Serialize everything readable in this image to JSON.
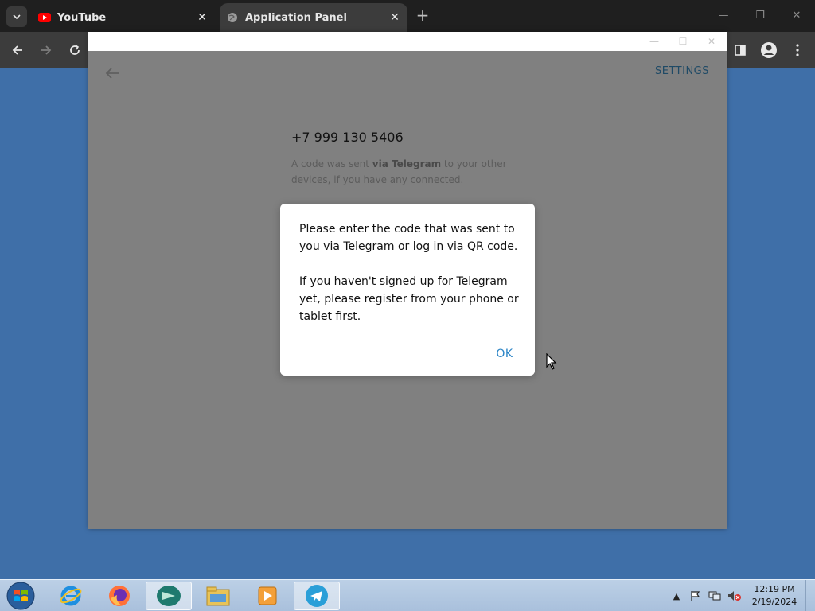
{
  "browser": {
    "tabs": [
      {
        "label": "YouTube",
        "icon": "youtube-icon"
      },
      {
        "label": "Application Panel",
        "icon": "globe-icon",
        "active": true
      }
    ],
    "new_tab_icon": "plus-icon"
  },
  "app": {
    "settings_label": "SETTINGS",
    "phone_number": "+7 999 130 5406",
    "hint_prefix": "A code was sent ",
    "hint_bold": "via Telegram",
    "hint_suffix": " to your other devices, if you have any connected."
  },
  "dialog": {
    "paragraph1": "Please enter the code that was sent to you via Telegram or log in via QR code.",
    "paragraph2": "If you haven't signed up for Telegram yet, please register from your phone or tablet first.",
    "ok_label": "OK"
  },
  "taskbar": {
    "apps": [
      "internet-explorer-icon",
      "firefox-icon",
      "app-icon",
      "file-explorer-icon",
      "media-player-icon",
      "telegram-icon"
    ],
    "clock_time": "12:19 PM",
    "clock_date": "2/19/2024"
  },
  "colors": {
    "desktop": "#3f6fa8",
    "link_blue": "#2a84c6",
    "settings_blue": "#1f4a66"
  }
}
